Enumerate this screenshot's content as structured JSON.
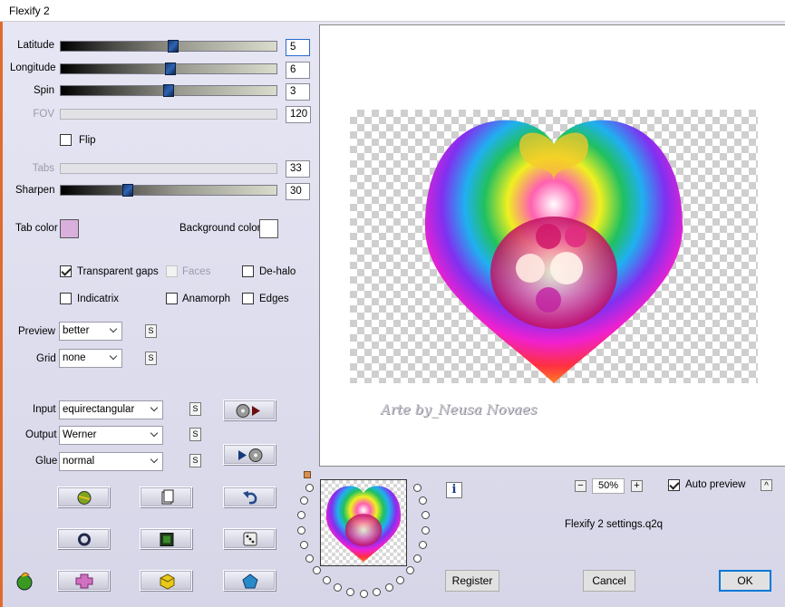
{
  "window": {
    "title": "Flexify 2"
  },
  "params": {
    "latitude": {
      "label": "Latitude",
      "value": "5",
      "level": 0.52
    },
    "longitude": {
      "label": "Longitude",
      "value": "6",
      "level": 0.51
    },
    "spin": {
      "label": "Spin",
      "value": "3",
      "level": 0.5
    },
    "fov": {
      "label": "FOV",
      "value": "120"
    },
    "flip": {
      "label": "Flip",
      "checked": false
    },
    "tabs": {
      "label": "Tabs",
      "value": "33"
    },
    "sharpen": {
      "label": "Sharpen",
      "value": "30",
      "level": 0.3
    }
  },
  "colors": {
    "tab_color_label": "Tab color",
    "tab_color": "#d9b0dc",
    "background_color_label": "Background color",
    "background_color": "#ffffff",
    "accent": "#0078d7"
  },
  "options": {
    "transparent_gaps": {
      "label": "Transparent gaps",
      "checked": true
    },
    "faces": {
      "label": "Faces",
      "checked": false,
      "disabled": true
    },
    "dehalo": {
      "label": "De-halo",
      "checked": false
    },
    "indicatrix": {
      "label": "Indicatrix",
      "checked": false
    },
    "anamorph": {
      "label": "Anamorph",
      "checked": false
    },
    "edges": {
      "label": "Edges",
      "checked": false
    }
  },
  "preview_opts": {
    "preview_label": "Preview",
    "preview_value": "better",
    "grid_label": "Grid",
    "grid_value": "none"
  },
  "projection": {
    "input_label": "Input",
    "input_value": "equirectangular",
    "output_label": "Output",
    "output_value": "Werner",
    "glue_label": "Glue",
    "glue_value": "normal",
    "s_label": "S"
  },
  "preview": {
    "watermark": "Arte by_Neusa Novaes"
  },
  "zoom": {
    "minus": "−",
    "value": "50%",
    "plus": "+"
  },
  "auto_preview": {
    "label": "Auto preview",
    "checked": true
  },
  "settings_file": "Flexify 2 settings.q2q",
  "info_label": "i",
  "help_label": "^",
  "buttons": {
    "register": "Register",
    "cancel": "Cancel",
    "ok": "OK"
  }
}
